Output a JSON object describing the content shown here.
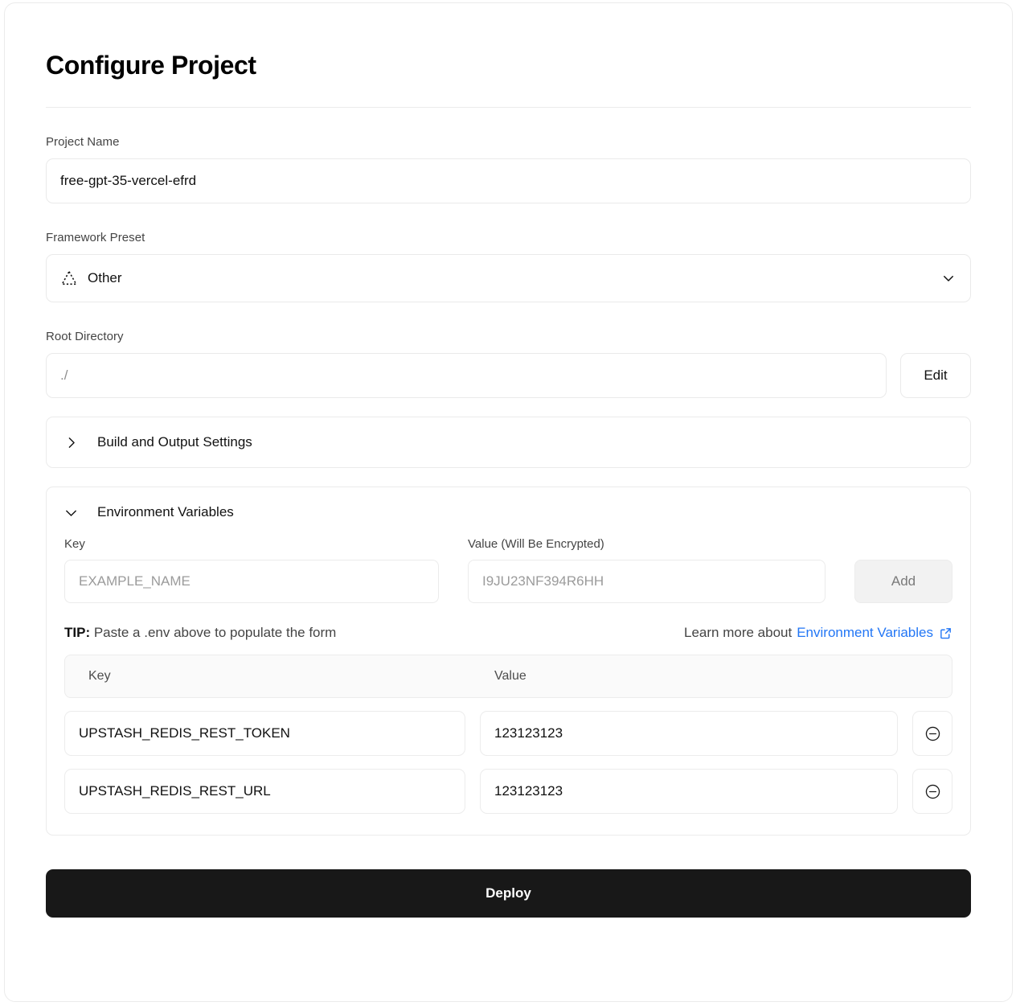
{
  "page": {
    "title": "Configure Project"
  },
  "project_name": {
    "label": "Project Name",
    "value": "free-gpt-35-vercel-efrd"
  },
  "framework_preset": {
    "label": "Framework Preset",
    "value": "Other",
    "icon": "dashed-triangle-icon",
    "chevron": "chevron-down-icon"
  },
  "root_directory": {
    "label": "Root Directory",
    "value": "./",
    "edit_label": "Edit"
  },
  "build_output": {
    "title": "Build and Output Settings",
    "expanded": false,
    "chevron": "chevron-right-icon"
  },
  "environment_variables": {
    "title": "Environment Variables",
    "expanded": true,
    "chevron": "chevron-down-icon",
    "key_label": "Key",
    "value_label": "Value (Will Be Encrypted)",
    "key_placeholder": "EXAMPLE_NAME",
    "value_placeholder": "I9JU23NF394R6HH",
    "add_label": "Add",
    "tip_prefix": "TIP:",
    "tip_text": "Paste a .env above to populate the form",
    "learn_more_prefix": "Learn more about",
    "learn_more_link": "Environment Variables",
    "learn_more_icon": "external-link-icon",
    "link_color": "#2276f5",
    "table": {
      "columns": [
        "Key",
        "Value"
      ],
      "rows": [
        {
          "key": "UPSTASH_REDIS_REST_TOKEN",
          "value": "123123123",
          "remove_icon": "circle-minus-icon"
        },
        {
          "key": "UPSTASH_REDIS_REST_URL",
          "value": "123123123",
          "remove_icon": "circle-minus-icon"
        }
      ]
    }
  },
  "deploy": {
    "label": "Deploy",
    "background": "#181818"
  }
}
